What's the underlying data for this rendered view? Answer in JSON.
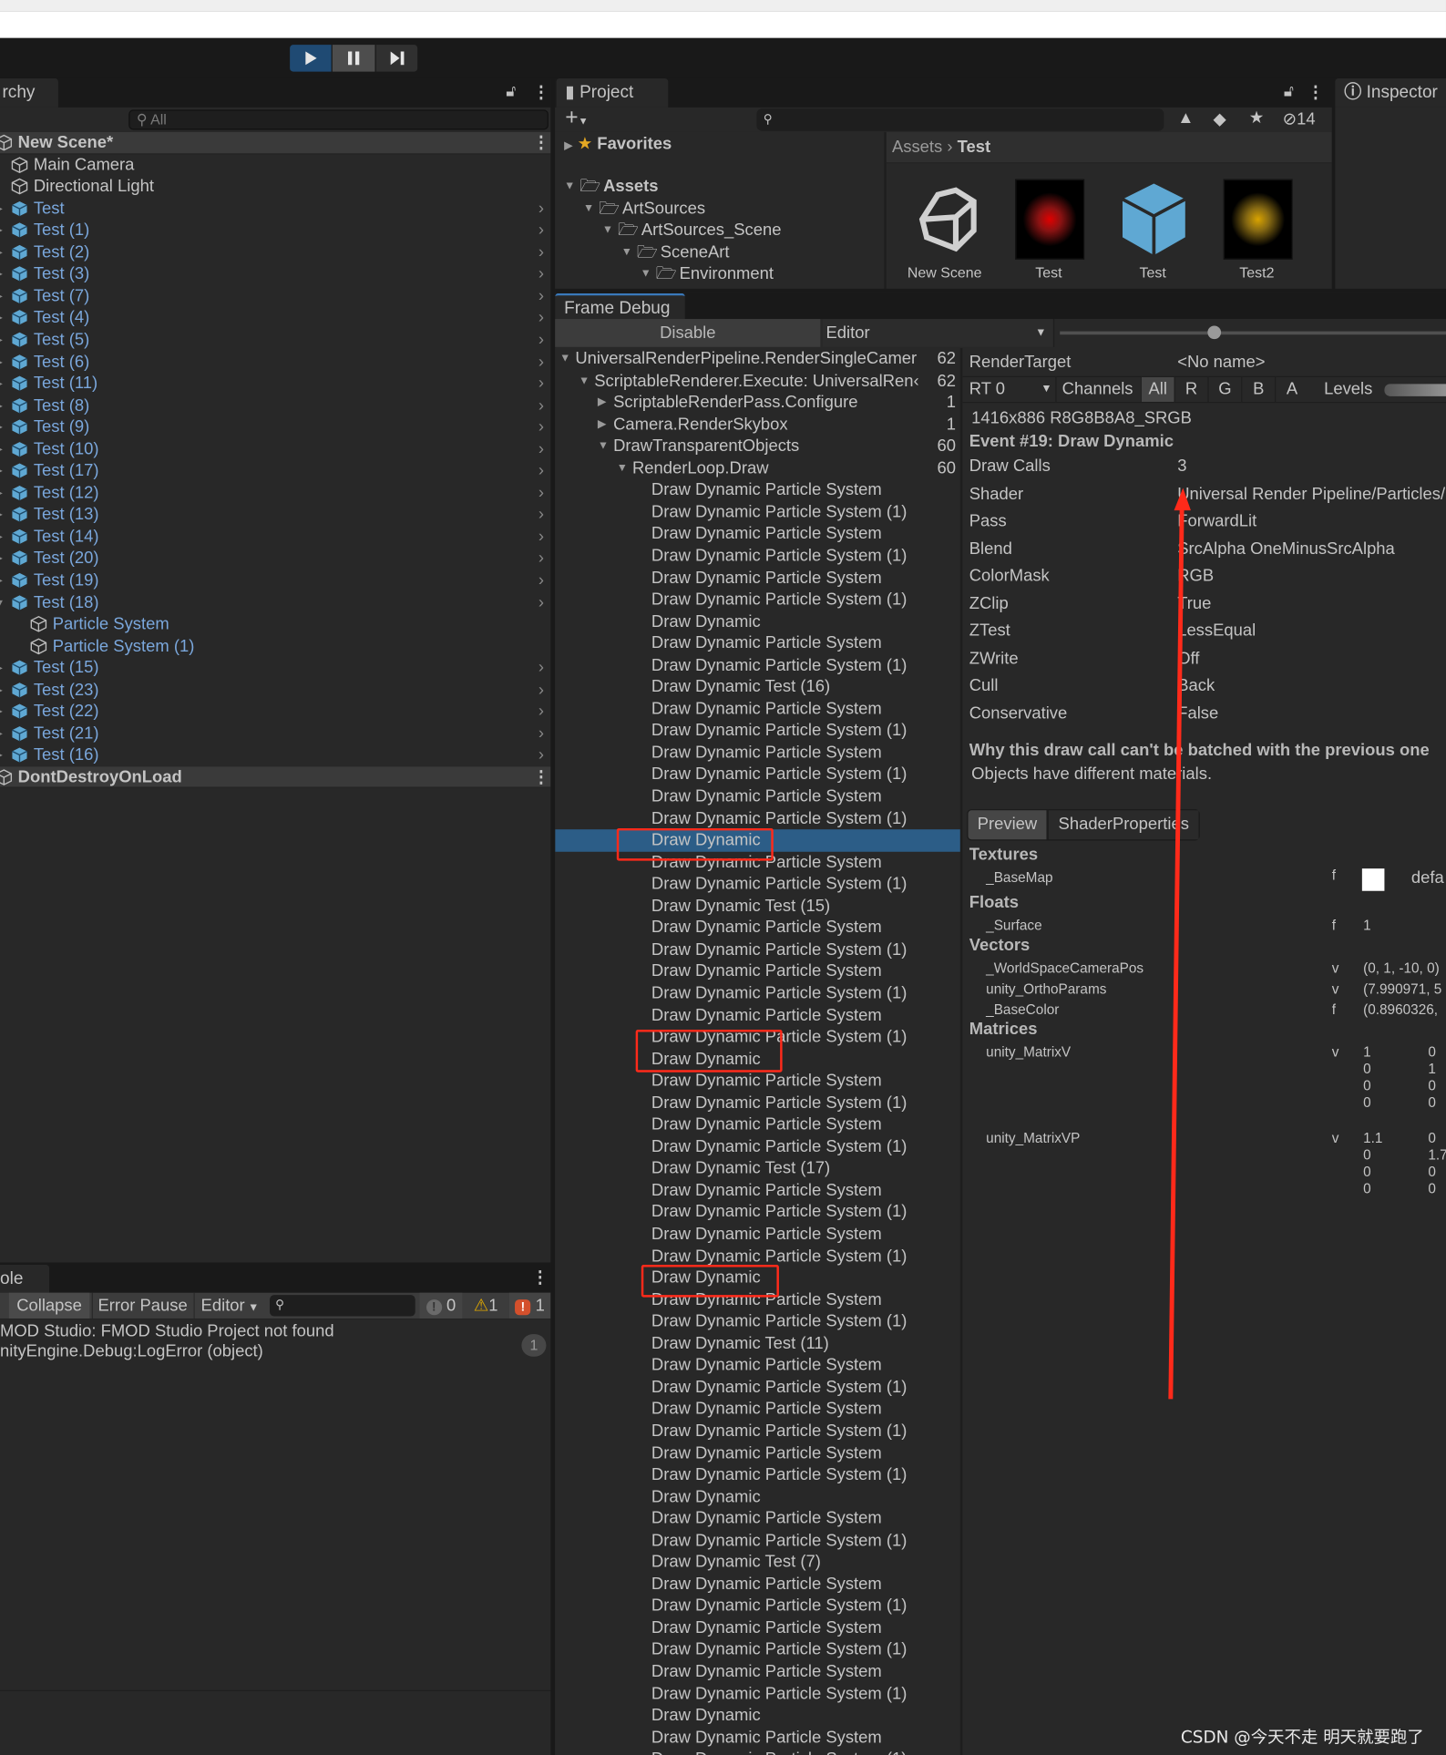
{
  "toolbar": {
    "play_icon": "play-icon",
    "pause_icon": "pause-icon",
    "step_icon": "step-icon"
  },
  "hierarchy": {
    "tab_label": "rchy",
    "search_placeholder": "All",
    "items": [
      {
        "label": "New Scene*",
        "type": "scene",
        "depth": 0
      },
      {
        "label": "Main Camera",
        "type": "object",
        "depth": 1
      },
      {
        "label": "Directional Light",
        "type": "object",
        "depth": 1
      },
      {
        "label": "Test",
        "type": "prefab",
        "depth": 1
      },
      {
        "label": "Test (1)",
        "type": "prefab",
        "depth": 1
      },
      {
        "label": "Test (2)",
        "type": "prefab",
        "depth": 1
      },
      {
        "label": "Test (3)",
        "type": "prefab",
        "depth": 1
      },
      {
        "label": "Test (7)",
        "type": "prefab",
        "depth": 1
      },
      {
        "label": "Test (4)",
        "type": "prefab",
        "depth": 1
      },
      {
        "label": "Test (5)",
        "type": "prefab",
        "depth": 1
      },
      {
        "label": "Test (6)",
        "type": "prefab",
        "depth": 1
      },
      {
        "label": "Test (11)",
        "type": "prefab",
        "depth": 1
      },
      {
        "label": "Test (8)",
        "type": "prefab",
        "depth": 1
      },
      {
        "label": "Test (9)",
        "type": "prefab",
        "depth": 1
      },
      {
        "label": "Test (10)",
        "type": "prefab",
        "depth": 1
      },
      {
        "label": "Test (17)",
        "type": "prefab",
        "depth": 1
      },
      {
        "label": "Test (12)",
        "type": "prefab",
        "depth": 1
      },
      {
        "label": "Test (13)",
        "type": "prefab",
        "depth": 1
      },
      {
        "label": "Test (14)",
        "type": "prefab",
        "depth": 1
      },
      {
        "label": "Test (20)",
        "type": "prefab",
        "depth": 1
      },
      {
        "label": "Test (19)",
        "type": "prefab",
        "depth": 1
      },
      {
        "label": "Test (18)",
        "type": "prefab",
        "depth": 1,
        "expanded": true
      },
      {
        "label": "Particle System",
        "type": "child",
        "depth": 2
      },
      {
        "label": "Particle System (1)",
        "type": "child",
        "depth": 2
      },
      {
        "label": "Test (15)",
        "type": "prefab",
        "depth": 1
      },
      {
        "label": "Test (23)",
        "type": "prefab",
        "depth": 1
      },
      {
        "label": "Test (22)",
        "type": "prefab",
        "depth": 1
      },
      {
        "label": "Test (21)",
        "type": "prefab",
        "depth": 1
      },
      {
        "label": "Test (16)",
        "type": "prefab",
        "depth": 1
      },
      {
        "label": "DontDestroyOnLoad",
        "type": "scene",
        "depth": 0
      }
    ]
  },
  "project": {
    "tab_label": "Project",
    "hidden_count": "14",
    "favorites": "Favorites",
    "tree": [
      {
        "label": "Assets",
        "depth": 0,
        "bold": true
      },
      {
        "label": "ArtSources",
        "depth": 1
      },
      {
        "label": "ArtSources_Scene",
        "depth": 2
      },
      {
        "label": "SceneArt",
        "depth": 3
      },
      {
        "label": "Environment",
        "depth": 4
      }
    ],
    "breadcrumb": [
      "Assets",
      "Test"
    ],
    "assets": [
      {
        "label": "New Scene",
        "kind": "unity-scene-icon"
      },
      {
        "label": "Test",
        "kind": "red-glow-material",
        "color": "#e00000"
      },
      {
        "label": "Test",
        "kind": "prefab-cube-icon",
        "color": "#5fa8d3"
      },
      {
        "label": "Test2",
        "kind": "yellow-glow-material",
        "color": "#d9a300"
      }
    ]
  },
  "inspector": {
    "tab_label": "Inspector"
  },
  "frame_debug": {
    "tab_label": "Frame Debug",
    "disable_label": "Disable",
    "target_dropdown": "Editor",
    "slider_fraction": 0.4,
    "tree": [
      {
        "label": "UniversalRenderPipeline.RenderSingleCamer",
        "count": "62",
        "depth": 0,
        "state": "expanded"
      },
      {
        "label": "ScriptableRenderer.Execute: UniversalRen‹",
        "count": "62",
        "depth": 1,
        "state": "expanded"
      },
      {
        "label": "ScriptableRenderPass.Configure",
        "count": "1",
        "depth": 2,
        "state": "collapsed"
      },
      {
        "label": "Camera.RenderSkybox",
        "count": "1",
        "depth": 2,
        "state": "collapsed"
      },
      {
        "label": "DrawTransparentObjects",
        "count": "60",
        "depth": 2,
        "state": "expanded"
      },
      {
        "label": "RenderLoop.Draw",
        "count": "60",
        "depth": 3,
        "state": "expanded"
      }
    ],
    "events": [
      "Draw Dynamic Particle System",
      "Draw Dynamic Particle System (1)",
      "Draw Dynamic Particle System",
      "Draw Dynamic Particle System (1)",
      "Draw Dynamic Particle System",
      "Draw Dynamic Particle System (1)",
      "Draw Dynamic",
      "Draw Dynamic Particle System",
      "Draw Dynamic Particle System (1)",
      "Draw Dynamic Test (16)",
      "Draw Dynamic Particle System",
      "Draw Dynamic Particle System (1)",
      "Draw Dynamic Particle System",
      "Draw Dynamic Particle System (1)",
      "Draw Dynamic Particle System",
      "Draw Dynamic Particle System (1)",
      "Draw Dynamic",
      "Draw Dynamic Particle System",
      "Draw Dynamic Particle System (1)",
      "Draw Dynamic Test (15)",
      "Draw Dynamic Particle System",
      "Draw Dynamic Particle System (1)",
      "Draw Dynamic Particle System",
      "Draw Dynamic Particle System (1)",
      "Draw Dynamic Particle System",
      "Draw Dynamic Particle System (1)",
      "Draw Dynamic",
      "Draw Dynamic Particle System",
      "Draw Dynamic Particle System (1)",
      "Draw Dynamic Particle System",
      "Draw Dynamic Particle System (1)",
      "Draw Dynamic Test (17)",
      "Draw Dynamic Particle System",
      "Draw Dynamic Particle System (1)",
      "Draw Dynamic Particle System",
      "Draw Dynamic Particle System (1)",
      "Draw Dynamic",
      "Draw Dynamic Particle System",
      "Draw Dynamic Particle System (1)",
      "Draw Dynamic Test (11)",
      "Draw Dynamic Particle System",
      "Draw Dynamic Particle System (1)",
      "Draw Dynamic Particle System",
      "Draw Dynamic Particle System (1)",
      "Draw Dynamic Particle System",
      "Draw Dynamic Particle System (1)",
      "Draw Dynamic",
      "Draw Dynamic Particle System",
      "Draw Dynamic Particle System (1)",
      "Draw Dynamic Test (7)",
      "Draw Dynamic Particle System",
      "Draw Dynamic Particle System (1)",
      "Draw Dynamic Particle System",
      "Draw Dynamic Particle System (1)",
      "Draw Dynamic Particle System",
      "Draw Dynamic Particle System (1)",
      "Draw Dynamic",
      "Draw Dynamic Particle System",
      "Draw Dynamic Particle System (1)"
    ],
    "selected_event_index": 16,
    "highlighted_event_indices": [
      16,
      25,
      26,
      36
    ],
    "details": {
      "render_target_label": "RenderTarget",
      "render_target_value": "<No name>",
      "rt_dropdown": "RT 0",
      "channels_label": "Channels",
      "channels": [
        "All",
        "R",
        "G",
        "B",
        "A"
      ],
      "levels_label": "Levels",
      "format": "1416x886 R8G8B8A8_SRGB",
      "event_title": "Event #19: Draw Dynamic",
      "props": [
        {
          "k": "Draw Calls",
          "v": "3"
        },
        {
          "k": "Shader",
          "v": "Universal Render Pipeline/Particles/Unlit"
        },
        {
          "k": "Pass",
          "v": "ForwardLit"
        },
        {
          "k": "Blend",
          "v": "SrcAlpha OneMinusSrcAlpha"
        },
        {
          "k": "ColorMask",
          "v": "RGB"
        },
        {
          "k": "ZClip",
          "v": "True"
        },
        {
          "k": "ZTest",
          "v": "LessEqual"
        },
        {
          "k": "ZWrite",
          "v": "Off"
        },
        {
          "k": "Cull",
          "v": "Back"
        },
        {
          "k": "Conservative",
          "v": "False"
        }
      ],
      "batch_heading": "Why this draw call can't be batched with the previous one",
      "batch_reason": "Objects have different materials.",
      "tabs": [
        "Preview",
        "ShaderProperties"
      ],
      "textures_heading": "Textures",
      "basemap": {
        "name": "_BaseMap",
        "type": "f",
        "value": "defa"
      },
      "floats_heading": "Floats",
      "surface": {
        "name": "_Surface",
        "type": "f",
        "value": "1"
      },
      "vectors_heading": "Vectors",
      "vectors": [
        {
          "name": "_WorldSpaceCameraPos",
          "type": "v",
          "value": "(0, 1, -10, 0)"
        },
        {
          "name": "unity_OrthoParams",
          "type": "v",
          "value": "(7.990971, 5"
        },
        {
          "name": "_BaseColor",
          "type": "f",
          "value": "(0.8960326,"
        }
      ],
      "matrices_heading": "Matrices",
      "matrices": [
        {
          "name": "unity_MatrixV",
          "type": "v",
          "col1": [
            "1",
            "0",
            "0",
            "0"
          ],
          "col2": [
            "0",
            "1",
            "0",
            "0"
          ]
        },
        {
          "name": "unity_MatrixVP",
          "type": "v",
          "col1": [
            "1.1",
            "0",
            "0",
            "0"
          ],
          "col2": [
            "0",
            "1.7",
            "0",
            "0"
          ]
        }
      ]
    }
  },
  "console": {
    "tab_label": "ole",
    "collapse": "Collapse",
    "error_pause": "Error Pause",
    "editor": "Editor",
    "info_count": "0",
    "warn_count": "1",
    "error_count": "1",
    "message_line1": "MOD Studio: FMOD Studio Project not found",
    "message_line2": "nityEngine.Debug:LogError (object)",
    "message_count": "1"
  },
  "watermark": "CSDN @今天不走 明天就要跑了",
  "annotation_color": "#ff2a1a"
}
